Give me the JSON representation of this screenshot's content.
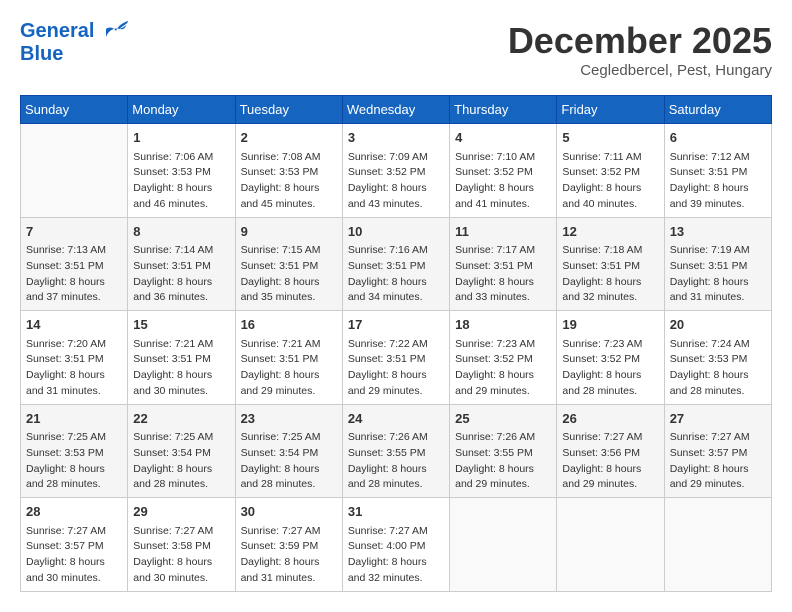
{
  "header": {
    "logo_line1": "General",
    "logo_line2": "Blue",
    "month": "December 2025",
    "location": "Cegledbercel, Pest, Hungary"
  },
  "days_of_week": [
    "Sunday",
    "Monday",
    "Tuesday",
    "Wednesday",
    "Thursday",
    "Friday",
    "Saturday"
  ],
  "weeks": [
    [
      {
        "day": "",
        "sunrise": "",
        "sunset": "",
        "daylight": ""
      },
      {
        "day": "1",
        "sunrise": "7:06 AM",
        "sunset": "3:53 PM",
        "daylight": "8 hours and 46 minutes."
      },
      {
        "day": "2",
        "sunrise": "7:08 AM",
        "sunset": "3:53 PM",
        "daylight": "8 hours and 45 minutes."
      },
      {
        "day": "3",
        "sunrise": "7:09 AM",
        "sunset": "3:52 PM",
        "daylight": "8 hours and 43 minutes."
      },
      {
        "day": "4",
        "sunrise": "7:10 AM",
        "sunset": "3:52 PM",
        "daylight": "8 hours and 41 minutes."
      },
      {
        "day": "5",
        "sunrise": "7:11 AM",
        "sunset": "3:52 PM",
        "daylight": "8 hours and 40 minutes."
      },
      {
        "day": "6",
        "sunrise": "7:12 AM",
        "sunset": "3:51 PM",
        "daylight": "8 hours and 39 minutes."
      }
    ],
    [
      {
        "day": "7",
        "sunrise": "7:13 AM",
        "sunset": "3:51 PM",
        "daylight": "8 hours and 37 minutes."
      },
      {
        "day": "8",
        "sunrise": "7:14 AM",
        "sunset": "3:51 PM",
        "daylight": "8 hours and 36 minutes."
      },
      {
        "day": "9",
        "sunrise": "7:15 AM",
        "sunset": "3:51 PM",
        "daylight": "8 hours and 35 minutes."
      },
      {
        "day": "10",
        "sunrise": "7:16 AM",
        "sunset": "3:51 PM",
        "daylight": "8 hours and 34 minutes."
      },
      {
        "day": "11",
        "sunrise": "7:17 AM",
        "sunset": "3:51 PM",
        "daylight": "8 hours and 33 minutes."
      },
      {
        "day": "12",
        "sunrise": "7:18 AM",
        "sunset": "3:51 PM",
        "daylight": "8 hours and 32 minutes."
      },
      {
        "day": "13",
        "sunrise": "7:19 AM",
        "sunset": "3:51 PM",
        "daylight": "8 hours and 31 minutes."
      }
    ],
    [
      {
        "day": "14",
        "sunrise": "7:20 AM",
        "sunset": "3:51 PM",
        "daylight": "8 hours and 31 minutes."
      },
      {
        "day": "15",
        "sunrise": "7:21 AM",
        "sunset": "3:51 PM",
        "daylight": "8 hours and 30 minutes."
      },
      {
        "day": "16",
        "sunrise": "7:21 AM",
        "sunset": "3:51 PM",
        "daylight": "8 hours and 29 minutes."
      },
      {
        "day": "17",
        "sunrise": "7:22 AM",
        "sunset": "3:51 PM",
        "daylight": "8 hours and 29 minutes."
      },
      {
        "day": "18",
        "sunrise": "7:23 AM",
        "sunset": "3:52 PM",
        "daylight": "8 hours and 29 minutes."
      },
      {
        "day": "19",
        "sunrise": "7:23 AM",
        "sunset": "3:52 PM",
        "daylight": "8 hours and 28 minutes."
      },
      {
        "day": "20",
        "sunrise": "7:24 AM",
        "sunset": "3:53 PM",
        "daylight": "8 hours and 28 minutes."
      }
    ],
    [
      {
        "day": "21",
        "sunrise": "7:25 AM",
        "sunset": "3:53 PM",
        "daylight": "8 hours and 28 minutes."
      },
      {
        "day": "22",
        "sunrise": "7:25 AM",
        "sunset": "3:54 PM",
        "daylight": "8 hours and 28 minutes."
      },
      {
        "day": "23",
        "sunrise": "7:25 AM",
        "sunset": "3:54 PM",
        "daylight": "8 hours and 28 minutes."
      },
      {
        "day": "24",
        "sunrise": "7:26 AM",
        "sunset": "3:55 PM",
        "daylight": "8 hours and 28 minutes."
      },
      {
        "day": "25",
        "sunrise": "7:26 AM",
        "sunset": "3:55 PM",
        "daylight": "8 hours and 29 minutes."
      },
      {
        "day": "26",
        "sunrise": "7:27 AM",
        "sunset": "3:56 PM",
        "daylight": "8 hours and 29 minutes."
      },
      {
        "day": "27",
        "sunrise": "7:27 AM",
        "sunset": "3:57 PM",
        "daylight": "8 hours and 29 minutes."
      }
    ],
    [
      {
        "day": "28",
        "sunrise": "7:27 AM",
        "sunset": "3:57 PM",
        "daylight": "8 hours and 30 minutes."
      },
      {
        "day": "29",
        "sunrise": "7:27 AM",
        "sunset": "3:58 PM",
        "daylight": "8 hours and 30 minutes."
      },
      {
        "day": "30",
        "sunrise": "7:27 AM",
        "sunset": "3:59 PM",
        "daylight": "8 hours and 31 minutes."
      },
      {
        "day": "31",
        "sunrise": "7:27 AM",
        "sunset": "4:00 PM",
        "daylight": "8 hours and 32 minutes."
      },
      {
        "day": "",
        "sunrise": "",
        "sunset": "",
        "daylight": ""
      },
      {
        "day": "",
        "sunrise": "",
        "sunset": "",
        "daylight": ""
      },
      {
        "day": "",
        "sunrise": "",
        "sunset": "",
        "daylight": ""
      }
    ]
  ]
}
